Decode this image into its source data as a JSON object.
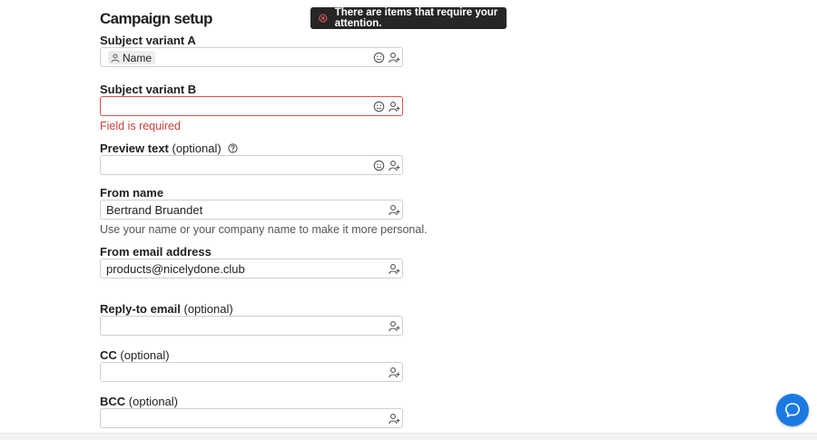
{
  "page": {
    "title": "Campaign setup"
  },
  "toast": {
    "message": "There are items that require your attention."
  },
  "optional_text": "(optional)",
  "fields": {
    "subject_a": {
      "label": "Subject variant A",
      "chip": "Name"
    },
    "subject_b": {
      "label": "Subject variant B",
      "error": "Field is required"
    },
    "preview_text": {
      "label": "Preview text"
    },
    "from_name": {
      "label": "From name",
      "value": "Bertrand Bruandet",
      "helper": "Use your name or your company name to make it more personal."
    },
    "from_email": {
      "label": "From email address",
      "value": "products@nicelydone.club"
    },
    "reply_to": {
      "label": "Reply-to email"
    },
    "cc": {
      "label": "CC"
    },
    "bcc": {
      "label": "BCC"
    }
  },
  "colors": {
    "error": "#d9534f",
    "help_button": "#1a7ae2",
    "toast_bg": "#262626"
  }
}
